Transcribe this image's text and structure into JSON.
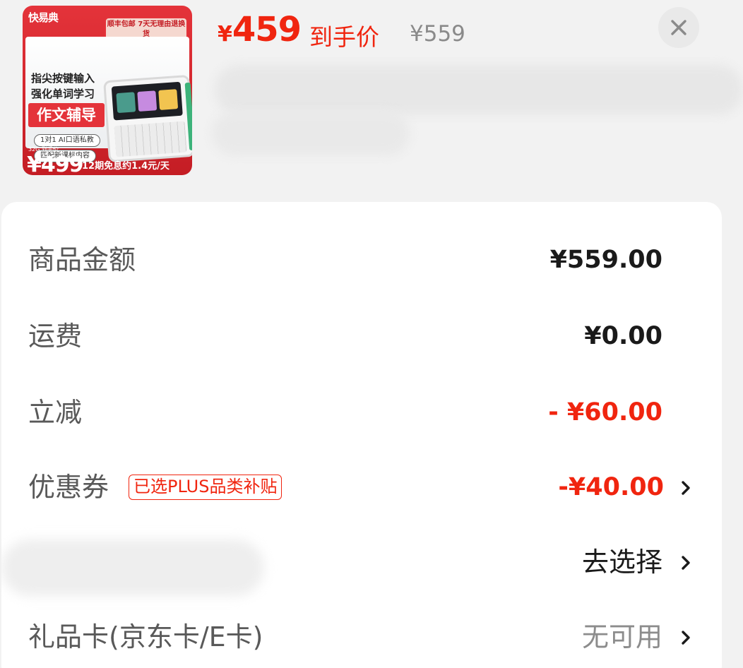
{
  "header": {
    "product_image": {
      "brand": "快易典",
      "ribbon": "顺丰包邮 7天无理由退换货",
      "line1": "指尖按键输入",
      "line2": "强化单词学习",
      "highlight": "作文辅导",
      "tag1": "1对1 AI口语私教",
      "tag2": "匹配新课标内容",
      "price_sub": "32G 到手价",
      "price": "¥499",
      "installment": "12期免息约1.4元/天"
    },
    "price_symbol": "¥",
    "price_amount": "459",
    "final_price_label": "到手价",
    "original_price": "¥559"
  },
  "summary": {
    "rows": [
      {
        "label": "商品金额",
        "value": "¥559.00"
      },
      {
        "label": "运费",
        "value": "¥0.00"
      },
      {
        "label": "立减",
        "value": "- ¥60.00"
      },
      {
        "label": "优惠券",
        "tag": "已选PLUS品类补贴",
        "value": "-¥40.00"
      },
      {
        "label": "",
        "value": "去选择"
      },
      {
        "label": "礼品卡(京东卡/E卡)",
        "value": "无可用"
      }
    ]
  },
  "colors": {
    "accent_red": "#f0250f",
    "text_dark": "#1a1a1a",
    "text_muted": "#8c8c8c",
    "background": "#f2f2f2"
  },
  "icons": [
    "close-icon",
    "chevron-right-icon"
  ]
}
